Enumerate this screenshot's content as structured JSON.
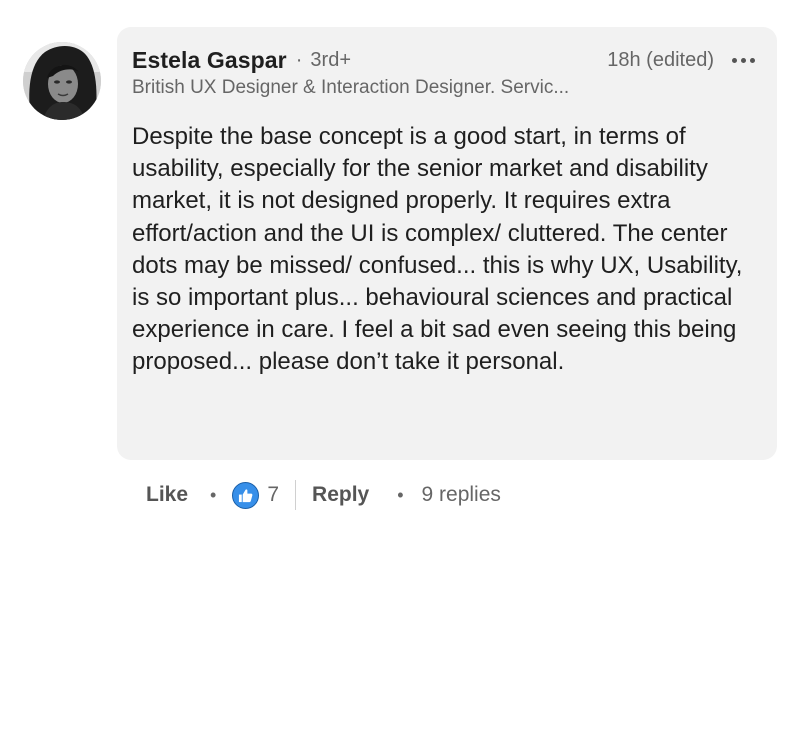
{
  "comment": {
    "author": {
      "name": "Estela Gaspar",
      "separator": "·",
      "degree": "3rd+",
      "headline": "British UX Designer & Interaction Designer. Servic..."
    },
    "timestamp": "18h (edited)",
    "more_icon": "ellipsis-horizontal-icon",
    "text": "Despite the base concept is a good start, in terms of usability, especially for the senior market and disability market, it is not designed properly. It requires extra effort/action and the UI is complex/ cluttered. The center dots may be missed/ confused... this is why UX, Usability, is so important plus... behavioural sciences and practical experience in care. I feel a bit sad even seeing this being proposed... please don’t take it personal."
  },
  "actions": {
    "like_label": "Like",
    "separator": "•",
    "reaction_icon": "thumbs-up-icon",
    "reaction_count": "7",
    "reply_label": "Reply",
    "replies_label": "9 replies"
  },
  "colors": {
    "bubble_background": "#f2f2f2",
    "primary_text": "#1f1f1f",
    "secondary_text": "#666666",
    "like_blue": "#378fe9"
  }
}
